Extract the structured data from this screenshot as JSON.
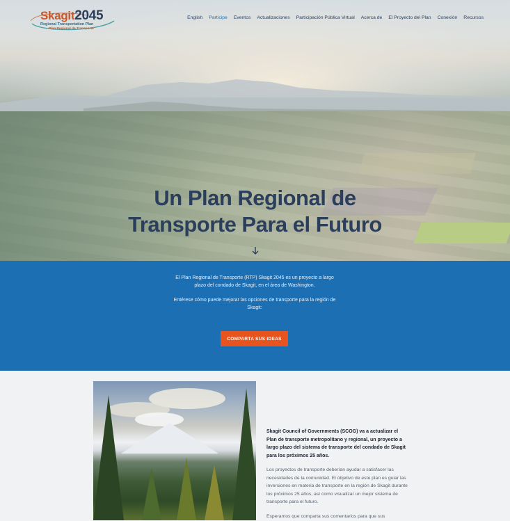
{
  "logo": {
    "brand_name": "Skagit",
    "brand_year": "2045",
    "subtitle_en": "Regional Transportation Plan",
    "subtitle_es": "Plan Regional de Transporte"
  },
  "nav": {
    "items": [
      {
        "label": "English"
      },
      {
        "label": "Participe"
      },
      {
        "label": "Eventos"
      },
      {
        "label": "Actualizaciones"
      },
      {
        "label": "Participación Pública Virtual"
      },
      {
        "label": "Acerca de"
      },
      {
        "label": "El Proyecto del Plan"
      },
      {
        "label": "Conexión"
      },
      {
        "label": "Recursos"
      }
    ],
    "active": "Participe"
  },
  "hero": {
    "title_line1": "Un Plan Regional de",
    "title_line2": "Transporte Para el Futuro",
    "scroll_icon": "arrow-down-icon"
  },
  "band": {
    "paragraph1": "El Plan Regional de Transporte (RTP) Skagit 2045 es un proyecto a largo plazo del condado de Skagit, en el área de Washington.",
    "paragraph2": "Entérese cómo puede mejorar las opciones de transporte para la región de Skagit:",
    "cta_label": "COMPARTA SUS IDEAS"
  },
  "content": {
    "lead": "Skagit Council of Governments (SCOG) va a actualizar el Plan de transporte metropolitano y regional, un proyecto a largo plazo del sistema de transporte del condado de Skagit para los próximos 25 años.",
    "body1": "Los proyectos de transporte deberían ayudar a satisfacer las necesidades de la comunidad. El objetivo de este plan es guiar las inversiones en materia de transporte en la región de Skagit durante los próximos 25 años, así como visualizar un mejor sistema de transporte para el futuro.",
    "body2": "Esperamos que comparta sus comentarios para que sus"
  },
  "colors": {
    "brand_navy": "#2b3e5c",
    "brand_orange": "#c8582a",
    "band_blue": "#1d6fb3",
    "cta_orange": "#e8541e",
    "nav_active": "#1a73b8"
  }
}
